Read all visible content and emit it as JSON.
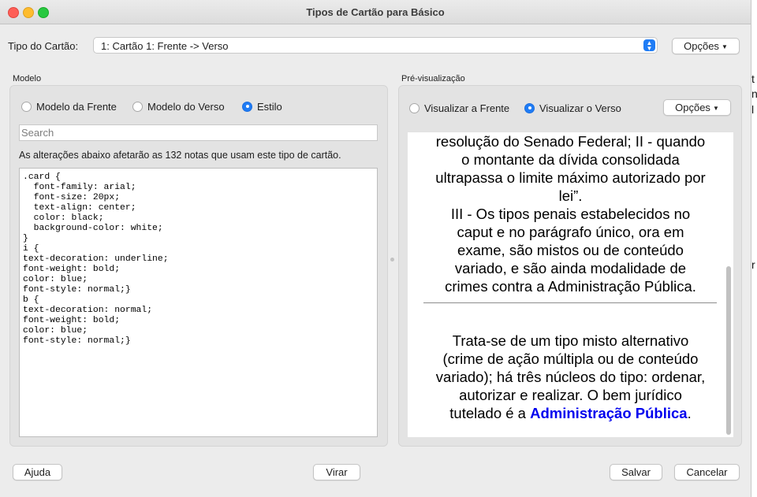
{
  "window": {
    "title": "Tipos de Cartão para Básico"
  },
  "card_type": {
    "label": "Tipo do Cartão:",
    "selected": "1: Cartão 1: Frente -> Verso",
    "options_button": "Opções"
  },
  "template_panel": {
    "title": "Modelo",
    "radios": [
      {
        "label": "Modelo da Frente",
        "checked": false
      },
      {
        "label": "Modelo do Verso",
        "checked": false
      },
      {
        "label": "Estilo",
        "checked": true
      }
    ],
    "search_placeholder": "Search",
    "notice": "As alterações abaixo afetarão as 132 notas que usam este tipo de cartão.",
    "css_code": ".card {\n  font-family: arial;\n  font-size: 20px;\n  text-align: center;\n  color: black;\n  background-color: white;\n}\ni {\ntext-decoration: underline;\nfont-weight: bold;\ncolor: blue;\nfont-style: normal;}\nb {\ntext-decoration: normal;\nfont-weight: bold;\ncolor: blue;\nfont-style: normal;}"
  },
  "preview_panel": {
    "title": "Pré-visualização",
    "radios": [
      {
        "label": "Visualizar a Frente",
        "checked": false
      },
      {
        "label": "Visualizar o Verso",
        "checked": true
      }
    ],
    "options_button": "Opções",
    "front_text_lines": [
      "resolução do Senado Federal; II - quando",
      "o montante da dívida consolidada",
      "ultrapassa o limite máximo autorizado por",
      "lei”.",
      "III - Os tipos penais estabelecidos no",
      "caput e no parágrafo único, ora em",
      "exame, são mistos ou de conteúdo",
      "variado, e são ainda modalidade de",
      "crimes contra a Administração Pública."
    ],
    "back_text_lines": [
      "Trata-se de um tipo misto alternativo",
      "(crime de ação múltipla ou de conteúdo",
      "variado); há três núcleos do tipo: ordenar,",
      "autorizar e realizar. O bem jurídico"
    ],
    "back_last_line_prefix": "tutelado é a ",
    "back_last_line_highlight": "Administração Pública",
    "back_last_line_suffix": "."
  },
  "footer": {
    "help": "Ajuda",
    "flip": "Virar",
    "save": "Salvar",
    "cancel": "Cancelar"
  },
  "background_fragments": [
    "t",
    "n",
    "l",
    "r"
  ]
}
